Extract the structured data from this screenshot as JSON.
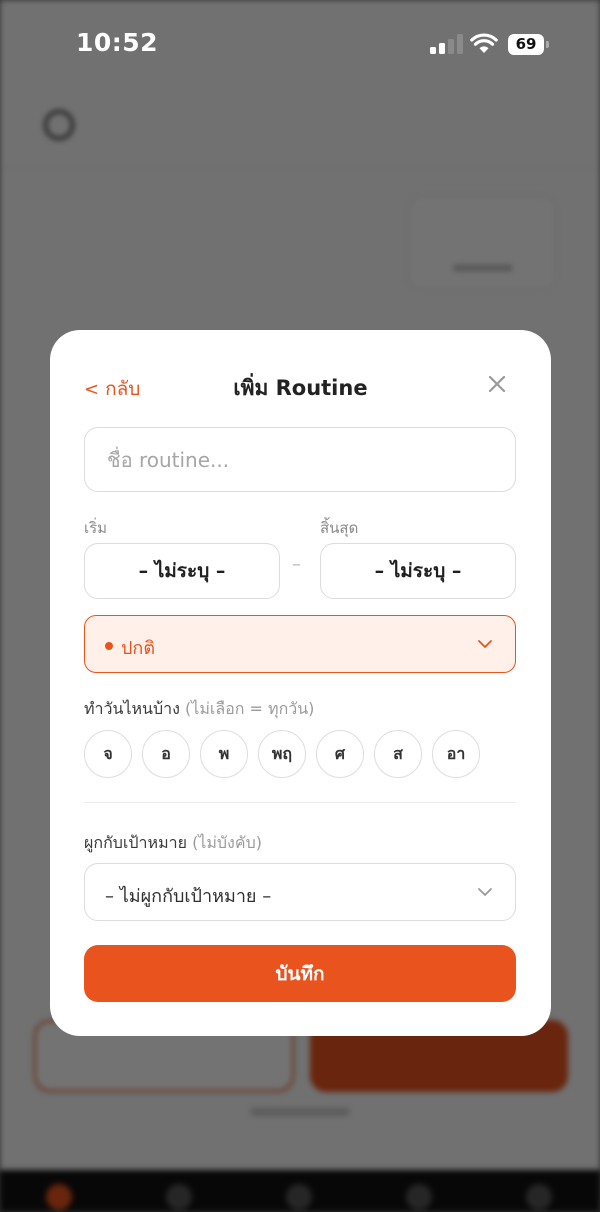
{
  "status_bar": {
    "time": "10:52",
    "battery": "69"
  },
  "modal": {
    "back_label": "กลับ",
    "title": "เพิ่ม Routine",
    "name_placeholder": "ชื่อ routine...",
    "start_label": "เริ่ม",
    "end_label": "สิ้นสุด",
    "start_value": "– ไม่ระบุ –",
    "end_value": "– ไม่ระบุ –",
    "date_separator": "–",
    "priority_value": "ปกติ",
    "days_label": "ทำวันไหนบ้าง",
    "days_hint": "(ไม่เลือก = ทุกวัน)",
    "days": [
      "จ",
      "อ",
      "พ",
      "พฤ",
      "ศ",
      "ส",
      "อา"
    ],
    "goal_label": "ผูกกับเป้าหมาย",
    "goal_hint": "(ไม่บังคับ)",
    "goal_value": "– ไม่ผูกกับเป้าหมาย –",
    "save_label": "บันทึก"
  },
  "colors": {
    "accent": "#e8531e",
    "accent_soft": "#fff1ea",
    "text": "#222222",
    "muted": "#8a8a8a"
  },
  "icons": {
    "back": "chevron-left-icon",
    "close": "close-icon",
    "dropdown": "chevron-down-icon"
  }
}
